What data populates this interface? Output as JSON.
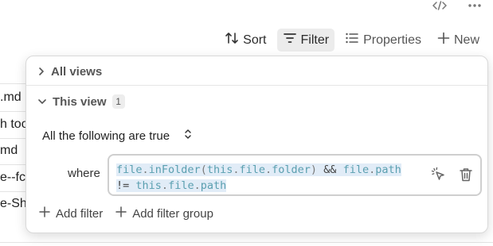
{
  "window": {
    "icons": [
      "code-icon",
      "more-icon"
    ]
  },
  "toolbar": {
    "sort_label": "Sort",
    "filter_label": "Filter",
    "properties_label": "Properties",
    "new_label": "New"
  },
  "background_rows": [
    ".md",
    "h too",
    "md",
    "e--fc",
    "e-Sh"
  ],
  "filter_panel": {
    "all_views_label": "All views",
    "this_view_label": "This view",
    "this_view_count": "1",
    "condition_mode": "All the following are true",
    "where_label": "where",
    "expression": {
      "t1": "file",
      "t2": ".",
      "t3": "inFolder",
      "t4": "(",
      "t5": "this",
      "t6": ".",
      "t7": "file",
      "t8": ".",
      "t9": "folder",
      "t10": ")",
      "t11": "&&",
      "t12": "file",
      "t13": ".",
      "t14": "path",
      "t15": "!=",
      "t16": "this",
      "t17": ".",
      "t18": "file",
      "t19": ".",
      "t20": "path"
    },
    "add_filter_label": "Add filter",
    "add_filter_group_label": "Add filter group"
  },
  "colors": {
    "code_token": "#5a9fb0",
    "selection": "#e1ecf7",
    "active_button_bg": "#ececec"
  }
}
